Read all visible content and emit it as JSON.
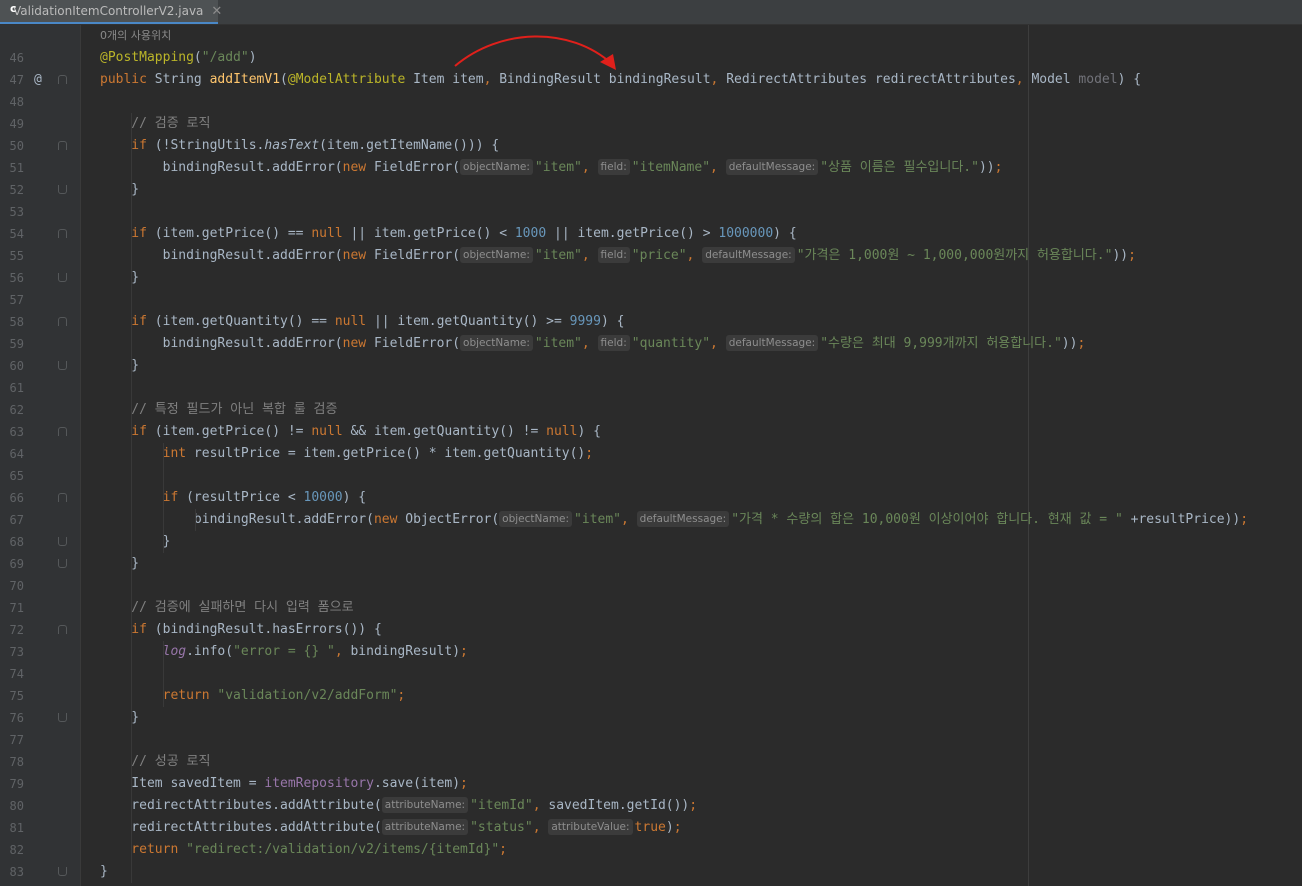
{
  "tab": {
    "filename": "ValidationItemControllerV2.java",
    "close": "✕",
    "icon": "java-class-icon"
  },
  "usages_hint": "0개의 사용위치",
  "gutter": {
    "override_marker": "@"
  },
  "colors": {
    "arrow": "#e0201b",
    "keyword": "#cc7832",
    "string": "#6a8759",
    "annotation": "#bbb529"
  },
  "lines": [
    {
      "no": "46",
      "tokens": [
        [
          "ann",
          "@PostMapping"
        ],
        [
          "",
          "("
        ],
        [
          "str",
          "\"/add\""
        ],
        [
          "",
          ")"
        ]
      ]
    },
    {
      "no": "47",
      "tokens": [
        [
          "kw",
          "public "
        ],
        [
          "",
          "String "
        ],
        [
          "fn",
          "addItemV1"
        ],
        [
          "",
          "("
        ],
        [
          "ann",
          "@ModelAttribute "
        ],
        [
          "",
          "Item item"
        ],
        [
          "kw",
          ", "
        ],
        [
          "",
          "BindingResult bindingResult"
        ],
        [
          "kw",
          ", "
        ],
        [
          "",
          "RedirectAttributes redirectAttributes"
        ],
        [
          "kw",
          ", "
        ],
        [
          "",
          "Model "
        ],
        [
          "param",
          "model"
        ],
        [
          "",
          ") {"
        ]
      ]
    },
    {
      "no": "48",
      "tokens": []
    },
    {
      "no": "49",
      "tokens": [
        [
          "cm",
          "    // 검증 로직"
        ]
      ]
    },
    {
      "no": "50",
      "tokens": [
        [
          "kw",
          "    if "
        ],
        [
          "",
          "(!StringUtils."
        ],
        [
          "italic",
          "hasText"
        ],
        [
          "",
          "(item.getItemName())) {"
        ]
      ]
    },
    {
      "no": "51",
      "tokens": [
        [
          "",
          "        bindingResult.addError("
        ],
        [
          "kw",
          "new "
        ],
        [
          "",
          "FieldError("
        ],
        [
          "hint",
          "objectName:"
        ],
        [
          "str",
          "\"item\""
        ],
        [
          "kw",
          ", "
        ],
        [
          "hint",
          "field:"
        ],
        [
          "str",
          "\"itemName\""
        ],
        [
          "kw",
          ", "
        ],
        [
          "hint",
          "defaultMessage:"
        ],
        [
          "str",
          "\"상품 이름은 필수입니다.\""
        ],
        [
          "",
          "))"
        ],
        [
          "kw",
          ";"
        ]
      ]
    },
    {
      "no": "52",
      "tokens": [
        [
          "",
          "    }"
        ]
      ]
    },
    {
      "no": "53",
      "tokens": []
    },
    {
      "no": "54",
      "tokens": [
        [
          "kw",
          "    if "
        ],
        [
          "",
          "(item.getPrice() == "
        ],
        [
          "kw",
          "null "
        ],
        [
          "",
          "|| item.getPrice() < "
        ],
        [
          "num",
          "1000 "
        ],
        [
          "",
          "|| item.getPrice() > "
        ],
        [
          "num",
          "1000000"
        ],
        [
          "",
          ") {"
        ]
      ]
    },
    {
      "no": "55",
      "tokens": [
        [
          "",
          "        bindingResult.addError("
        ],
        [
          "kw",
          "new "
        ],
        [
          "",
          "FieldError("
        ],
        [
          "hint",
          "objectName:"
        ],
        [
          "str",
          "\"item\""
        ],
        [
          "kw",
          ", "
        ],
        [
          "hint",
          "field:"
        ],
        [
          "str",
          "\"price\""
        ],
        [
          "kw",
          ", "
        ],
        [
          "hint",
          "defaultMessage:"
        ],
        [
          "str",
          "\"가격은 1,000원 ~ 1,000,000원까지 허용합니다.\""
        ],
        [
          "",
          "))"
        ],
        [
          "kw",
          ";"
        ]
      ]
    },
    {
      "no": "56",
      "tokens": [
        [
          "",
          "    }"
        ]
      ]
    },
    {
      "no": "57",
      "tokens": []
    },
    {
      "no": "58",
      "tokens": [
        [
          "kw",
          "    if "
        ],
        [
          "",
          "(item.getQuantity() == "
        ],
        [
          "kw",
          "null "
        ],
        [
          "",
          "|| item.getQuantity() >= "
        ],
        [
          "num",
          "9999"
        ],
        [
          "",
          ") {"
        ]
      ]
    },
    {
      "no": "59",
      "tokens": [
        [
          "",
          "        bindingResult.addError("
        ],
        [
          "kw",
          "new "
        ],
        [
          "",
          "FieldError("
        ],
        [
          "hint",
          "objectName:"
        ],
        [
          "str",
          "\"item\""
        ],
        [
          "kw",
          ", "
        ],
        [
          "hint",
          "field:"
        ],
        [
          "str",
          "\"quantity\""
        ],
        [
          "kw",
          ", "
        ],
        [
          "hint",
          "defaultMessage:"
        ],
        [
          "str",
          "\"수량은 최대 9,999개까지 허용합니다.\""
        ],
        [
          "",
          "))"
        ],
        [
          "kw",
          ";"
        ]
      ]
    },
    {
      "no": "60",
      "tokens": [
        [
          "",
          "    }"
        ]
      ]
    },
    {
      "no": "61",
      "tokens": []
    },
    {
      "no": "62",
      "tokens": [
        [
          "cm",
          "    // 특정 필드가 아닌 복합 룰 검증"
        ]
      ]
    },
    {
      "no": "63",
      "tokens": [
        [
          "kw",
          "    if "
        ],
        [
          "",
          "(item.getPrice() != "
        ],
        [
          "kw",
          "null "
        ],
        [
          "",
          "&& item.getQuantity() != "
        ],
        [
          "kw",
          "null"
        ],
        [
          "",
          ") {"
        ]
      ]
    },
    {
      "no": "64",
      "tokens": [
        [
          "kw",
          "        int "
        ],
        [
          "",
          "resultPrice = item.getPrice() * item.getQuantity()"
        ],
        [
          "kw",
          ";"
        ]
      ]
    },
    {
      "no": "65",
      "tokens": []
    },
    {
      "no": "66",
      "tokens": [
        [
          "kw",
          "        if "
        ],
        [
          "",
          "(resultPrice < "
        ],
        [
          "num",
          "10000"
        ],
        [
          "",
          ") {"
        ]
      ]
    },
    {
      "no": "67",
      "tokens": [
        [
          "",
          "            bindingResult.addError("
        ],
        [
          "kw",
          "new "
        ],
        [
          "",
          "ObjectError("
        ],
        [
          "hint",
          "objectName:"
        ],
        [
          "str",
          "\"item\""
        ],
        [
          "kw",
          ", "
        ],
        [
          "hint",
          "defaultMessage:"
        ],
        [
          "str",
          "\"가격 * 수량의 합은 10,000원 이상이어야 합니다. 현재 값 = \" "
        ],
        [
          "",
          "+resultPrice))"
        ],
        [
          "kw",
          ";"
        ]
      ]
    },
    {
      "no": "68",
      "tokens": [
        [
          "",
          "        }"
        ]
      ]
    },
    {
      "no": "69",
      "tokens": [
        [
          "",
          "    }"
        ]
      ]
    },
    {
      "no": "70",
      "tokens": []
    },
    {
      "no": "71",
      "tokens": [
        [
          "cm",
          "    // 검증에 실패하면 다시 입력 폼으로"
        ]
      ]
    },
    {
      "no": "72",
      "tokens": [
        [
          "kw",
          "    if "
        ],
        [
          "",
          "(bindingResult.hasErrors()) {"
        ]
      ]
    },
    {
      "no": "73",
      "tokens": [
        [
          "mem italic",
          "        log"
        ],
        [
          "",
          ".info("
        ],
        [
          "str",
          "\"error = {} \""
        ],
        [
          "kw",
          ", "
        ],
        [
          "",
          "bindingResult)"
        ],
        [
          "kw",
          ";"
        ]
      ]
    },
    {
      "no": "74",
      "tokens": []
    },
    {
      "no": "75",
      "tokens": [
        [
          "kw",
          "        return "
        ],
        [
          "str",
          "\"validation/v2/addForm\""
        ],
        [
          "kw",
          ";"
        ]
      ]
    },
    {
      "no": "76",
      "tokens": [
        [
          "",
          "    }"
        ]
      ]
    },
    {
      "no": "77",
      "tokens": []
    },
    {
      "no": "78",
      "tokens": [
        [
          "cm",
          "    // 성공 로직"
        ]
      ]
    },
    {
      "no": "79",
      "tokens": [
        [
          "",
          "    Item savedItem = "
        ],
        [
          "mem",
          "itemRepository"
        ],
        [
          "",
          ".save(item)"
        ],
        [
          "kw",
          ";"
        ]
      ]
    },
    {
      "no": "80",
      "tokens": [
        [
          "",
          "    redirectAttributes.addAttribute("
        ],
        [
          "hint",
          "attributeName:"
        ],
        [
          "str",
          "\"itemId\""
        ],
        [
          "kw",
          ", "
        ],
        [
          "",
          "savedItem.getId())"
        ],
        [
          "kw",
          ";"
        ]
      ]
    },
    {
      "no": "81",
      "tokens": [
        [
          "",
          "    redirectAttributes.addAttribute("
        ],
        [
          "hint",
          "attributeName:"
        ],
        [
          "str",
          "\"status\""
        ],
        [
          "kw",
          ", "
        ],
        [
          "hint",
          "attributeValue:"
        ],
        [
          "kw",
          "true"
        ],
        [
          "",
          ")"
        ],
        [
          "kw",
          ";"
        ]
      ]
    },
    {
      "no": "82",
      "tokens": [
        [
          "kw",
          "    return "
        ],
        [
          "str",
          "\"redirect:/validation/v2/items/{itemId}\""
        ],
        [
          "kw",
          ";"
        ]
      ]
    },
    {
      "no": "83",
      "tokens": [
        [
          "",
          "}"
        ]
      ]
    }
  ]
}
